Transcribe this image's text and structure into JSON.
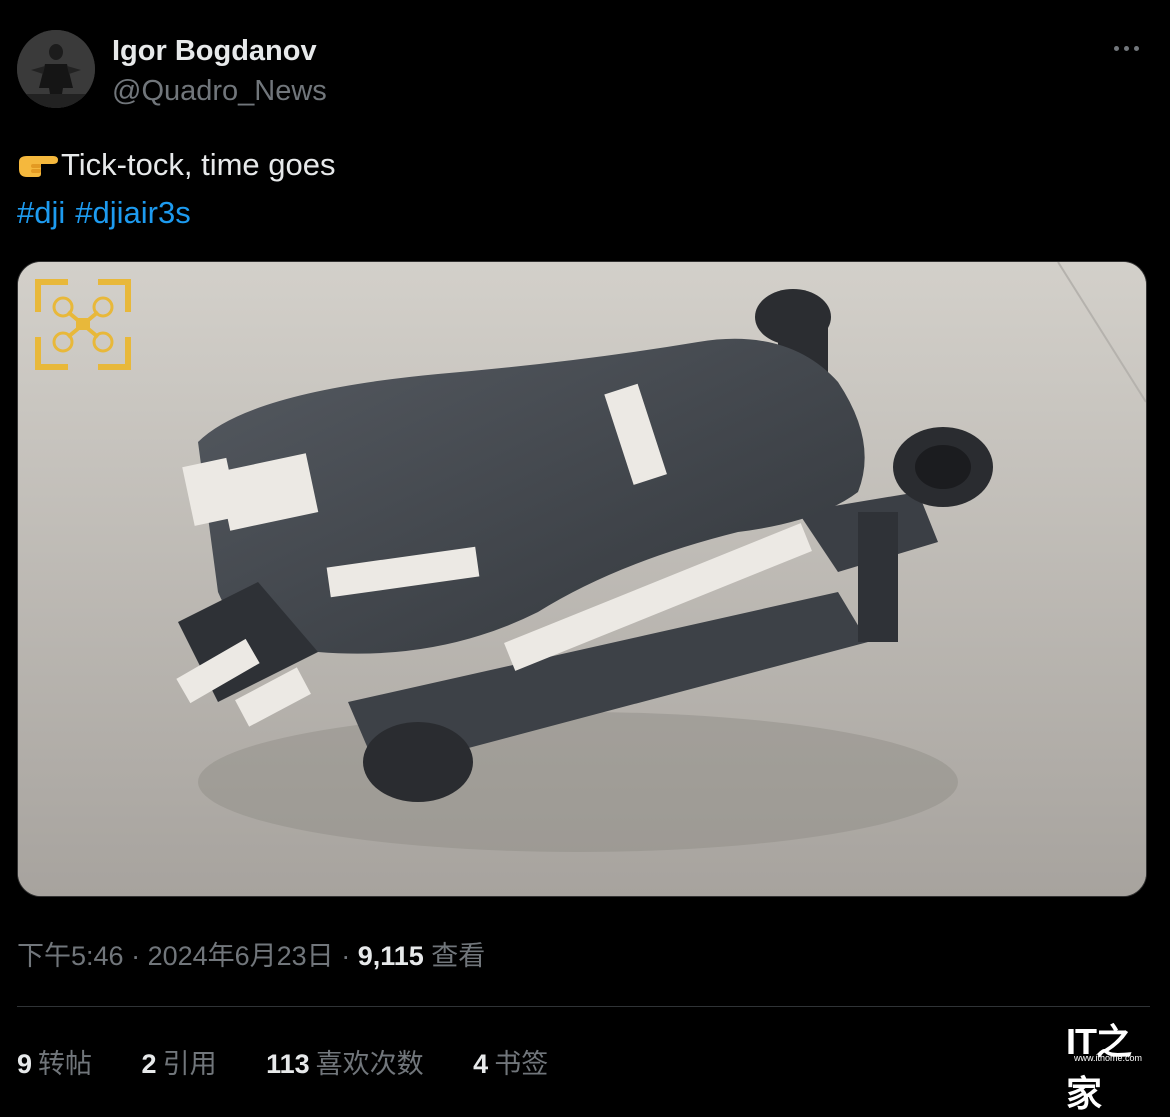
{
  "author": {
    "name": "Igor Bogdanov",
    "handle": "@Quadro_News"
  },
  "tweet": {
    "emoji": "pointing-hand-emoji",
    "text": "Tick-tock, time goes",
    "hashtags": [
      "#dji",
      "#djiair3s"
    ]
  },
  "media": {
    "description_icon": "drone-photo"
  },
  "meta": {
    "time": "下午5:46",
    "sep1": " · ",
    "date": "2024年6月23日",
    "sep2": " · ",
    "views": "9,115",
    "views_label": " 查看"
  },
  "stats": [
    {
      "count": "9",
      "label": "转帖"
    },
    {
      "count": "2",
      "label": "引用"
    },
    {
      "count": "113",
      "label": "喜欢次数"
    },
    {
      "count": "4",
      "label": "书签"
    }
  ],
  "watermark": {
    "logo": "IT之家",
    "url": "www.ithome.com"
  },
  "colors": {
    "background": "#000000",
    "hashtag": "#1d9bf0",
    "muted": "#71767b",
    "text": "#e7e9ea"
  }
}
